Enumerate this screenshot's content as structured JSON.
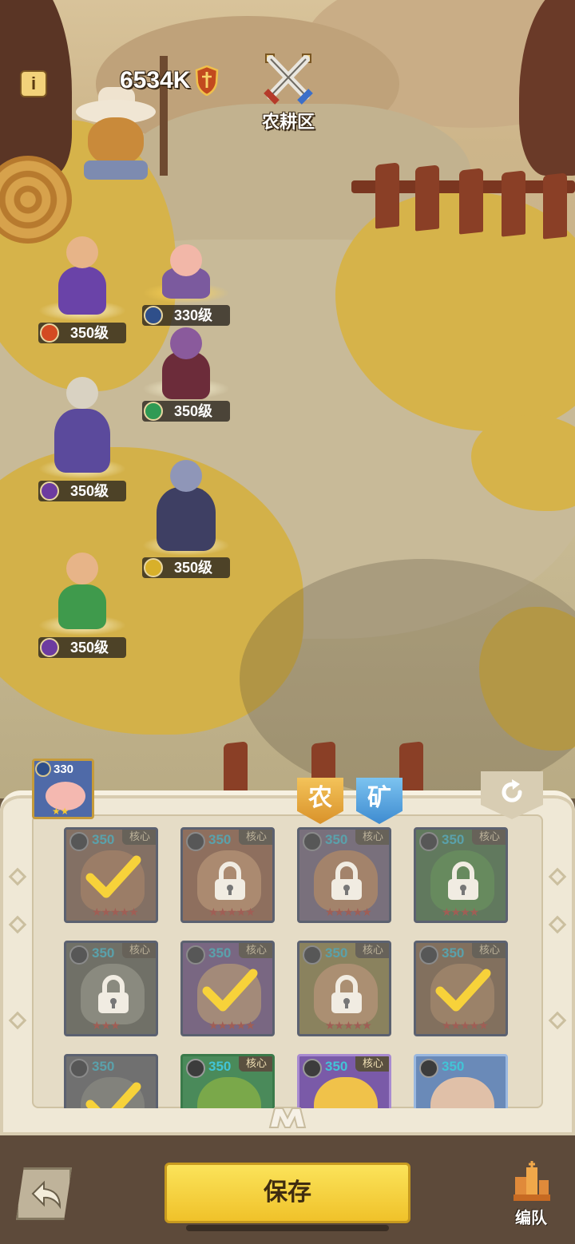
{
  "hud": {
    "info_label": "i",
    "power": "6534K",
    "zone_label": "农耕区"
  },
  "field_heroes": [
    {
      "level": "350级",
      "element": "fire"
    },
    {
      "level": "330级",
      "element": "wind"
    },
    {
      "level": "350级",
      "element": "nature"
    },
    {
      "level": "350级",
      "element": "arcane"
    },
    {
      "level": "350级",
      "element": "holy"
    },
    {
      "level": "350级",
      "element": "arcane"
    }
  ],
  "selected_hero": {
    "level": "330",
    "stars": "★★"
  },
  "tabs": {
    "farm": "农",
    "mine": "矿"
  },
  "cards": [
    {
      "level": "350",
      "core": "核心",
      "stars": "★★★★★",
      "state": "selected"
    },
    {
      "level": "350",
      "core": "核心",
      "stars": "★★★★★",
      "state": "locked"
    },
    {
      "level": "350",
      "core": "核心",
      "stars": "★★★★★",
      "state": "locked"
    },
    {
      "level": "350",
      "core": "核心",
      "stars": "★★★★",
      "state": "locked"
    },
    {
      "level": "350",
      "core": "核心",
      "stars": "★★★",
      "state": "locked"
    },
    {
      "level": "350",
      "core": "核心",
      "stars": "★★★★★",
      "state": "selected"
    },
    {
      "level": "350",
      "core": "核心",
      "stars": "★★★★★",
      "state": "locked"
    },
    {
      "level": "350",
      "core": "核心",
      "stars": "★★★★★",
      "state": "selected"
    },
    {
      "level": "350",
      "core": "",
      "stars": "",
      "state": "selected"
    },
    {
      "level": "350",
      "core": "核心",
      "stars": "",
      "state": "none"
    },
    {
      "level": "350",
      "core": "核心",
      "stars": "",
      "state": "none"
    },
    {
      "level": "350",
      "core": "",
      "stars": "",
      "state": "none"
    }
  ],
  "footer": {
    "save_label": "保存",
    "formation_label": "编队"
  },
  "colors": {
    "accent_gold": "#f3c836",
    "level_cyan": "#42c4d6",
    "star_red": "#c24a3a"
  }
}
